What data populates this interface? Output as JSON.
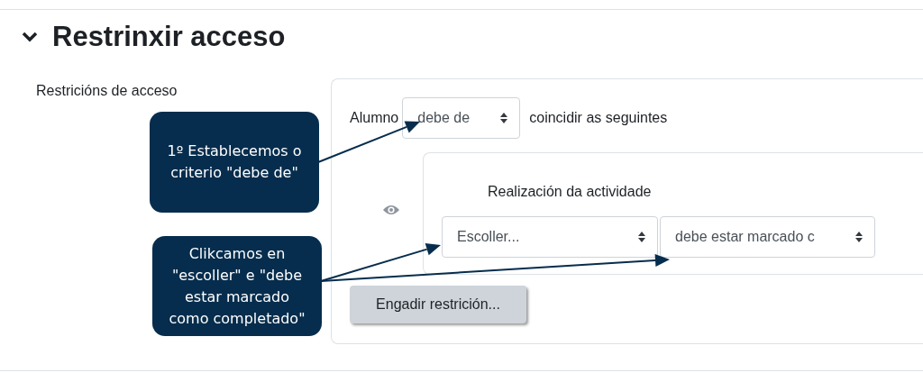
{
  "section": {
    "title": "Restrinxir acceso",
    "expanded": true
  },
  "field_label": "Restricións de acceso",
  "restriction_set": {
    "prefix": "Alumno",
    "mode_select": "debe de",
    "suffix": "coincidir as seguintes",
    "conditions": [
      {
        "visible": true,
        "title": "Realización da actividade",
        "selects": [
          "Escoller...",
          "debe estar marcado c"
        ]
      }
    ],
    "add_button": "Engadir restrición..."
  },
  "callouts": [
    {
      "text": "1º Establecemos o criterio \"debe de\""
    },
    {
      "text": "Clikcamos en \"escoller\" e \"debe estar marcado como completado\""
    }
  ]
}
